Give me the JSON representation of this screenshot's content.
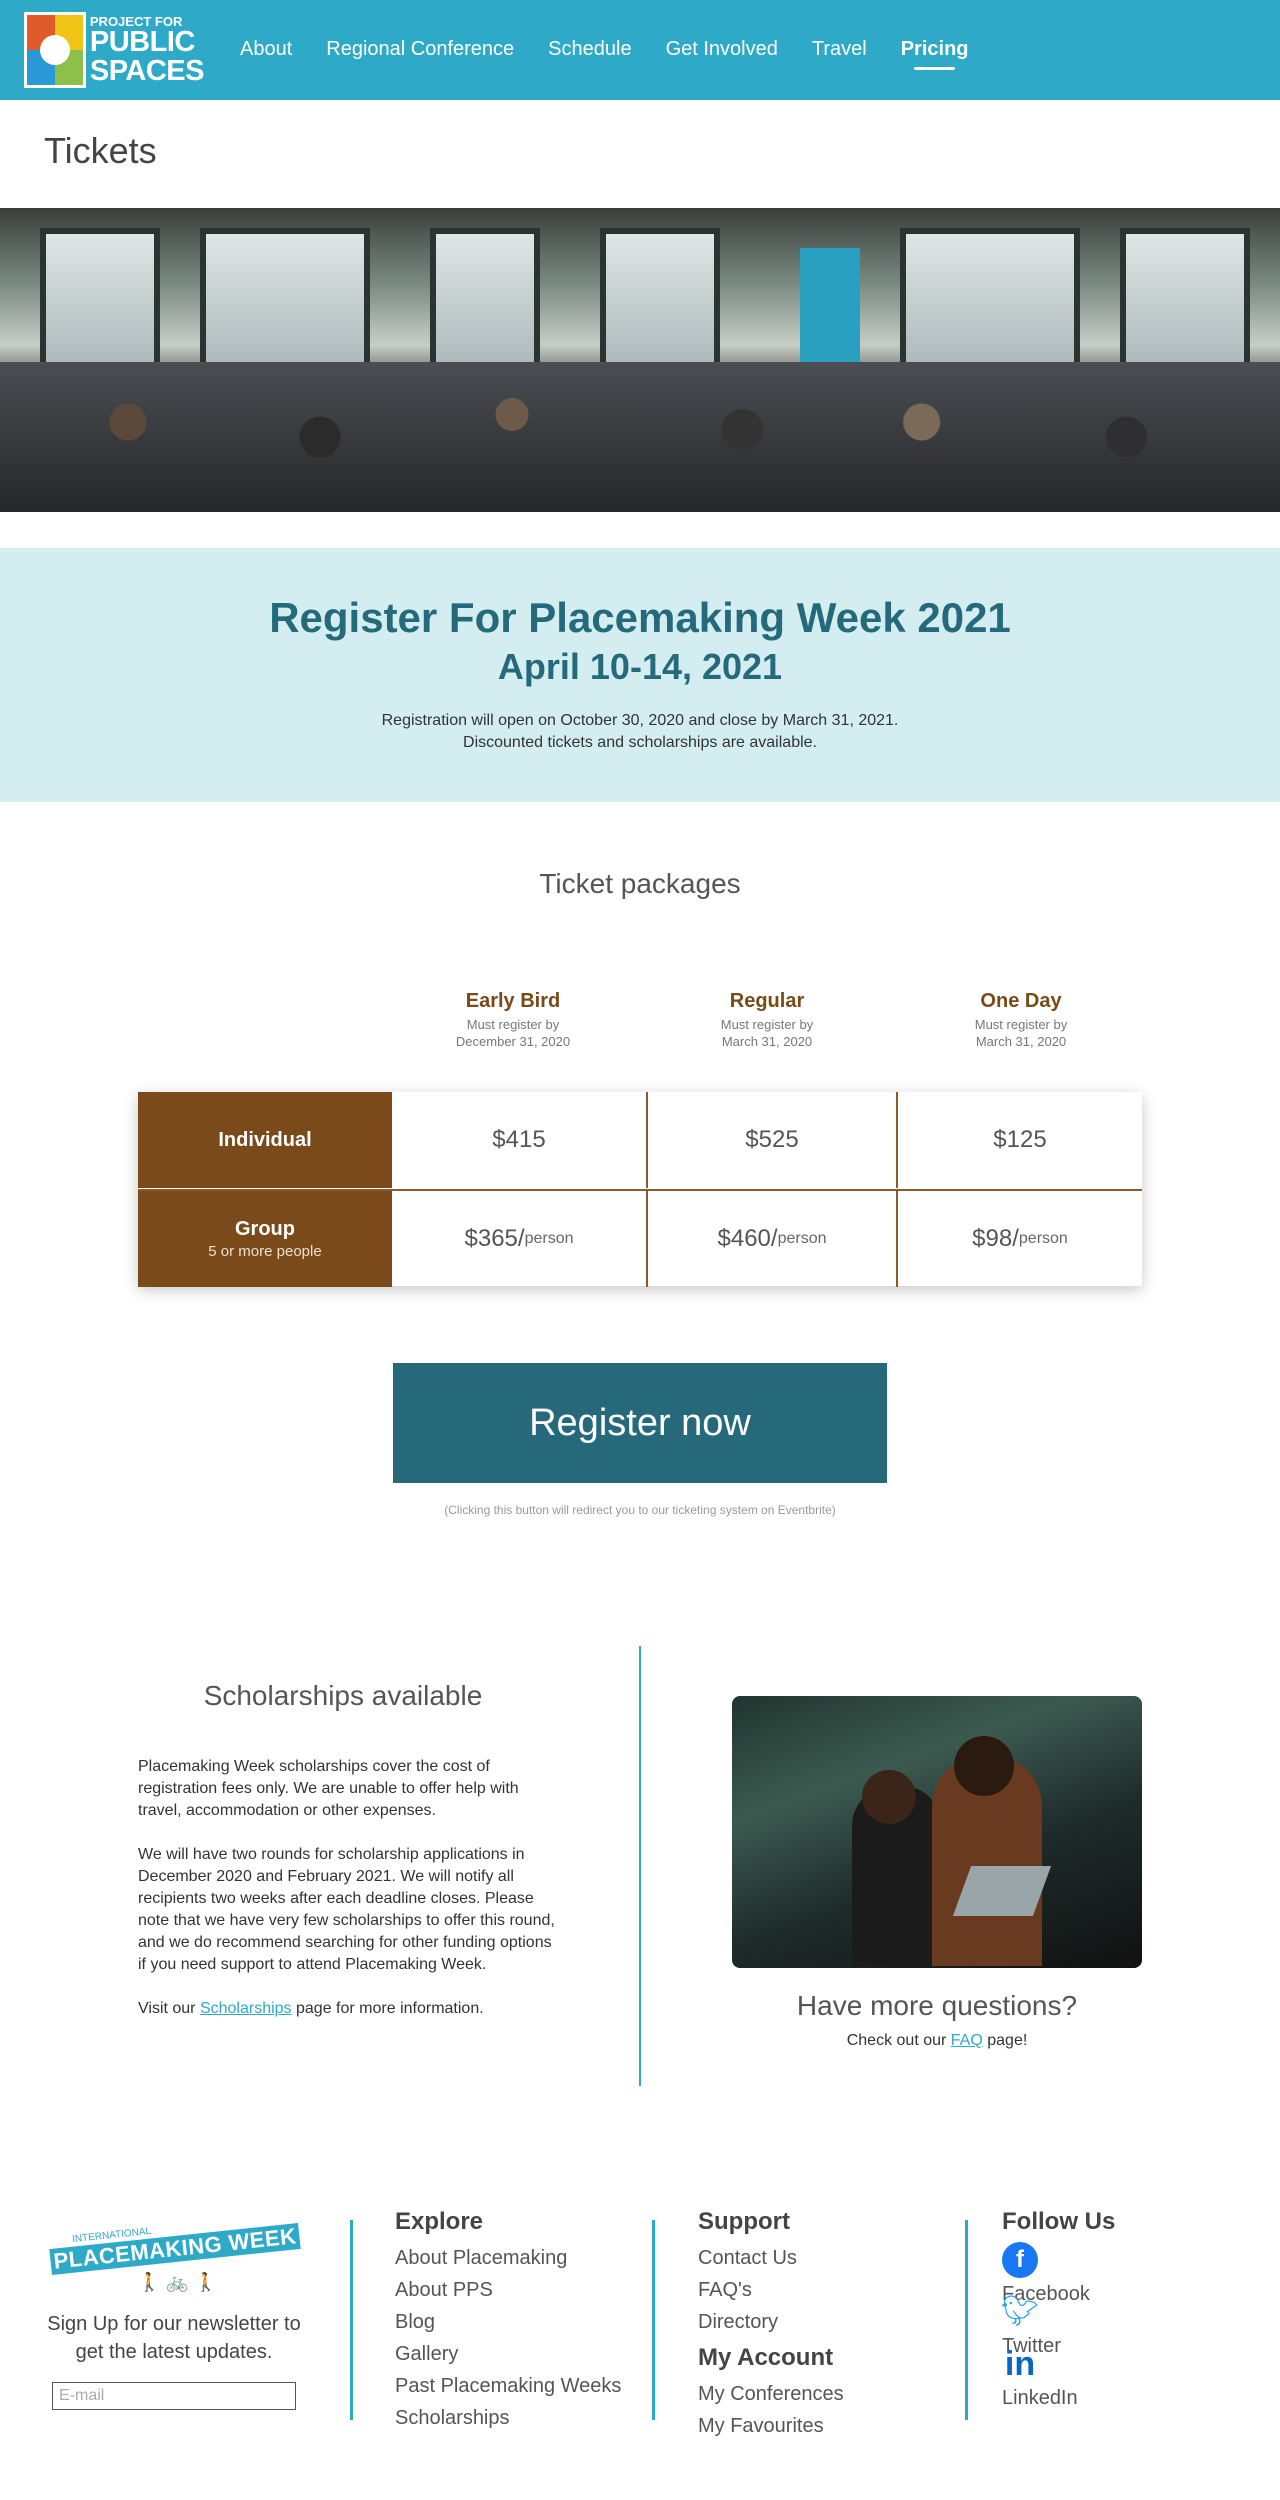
{
  "header": {
    "logo_small": "PROJECT FOR",
    "logo_big_1": "PUBLIC",
    "logo_big_2": "SPACES",
    "nav": [
      {
        "label": "About"
      },
      {
        "label": "Regional Conference"
      },
      {
        "label": "Schedule"
      },
      {
        "label": "Get Involved"
      },
      {
        "label": "Travel"
      },
      {
        "label": "Pricing",
        "active": true
      }
    ]
  },
  "page_title": "Tickets",
  "register": {
    "heading": "Register For Placemaking Week 2021",
    "dates": "April 10-14, 2021",
    "line1": "Registration will open on October 30, 2020 and close by March 31, 2021.",
    "line2": "Discounted tickets and scholarships are available."
  },
  "packages": {
    "title": "Ticket packages",
    "columns": [
      {
        "name": "Early Bird",
        "sub1": "Must register by",
        "sub2": "December 31, 2020"
      },
      {
        "name": "Regular",
        "sub1": "Must register by",
        "sub2": "March 31, 2020"
      },
      {
        "name": "One Day",
        "sub1": "Must register by",
        "sub2": "March 31, 2020"
      }
    ],
    "rows": [
      {
        "label": "Individual",
        "sublabel": "",
        "prices": [
          "$415",
          "$525",
          "$125"
        ],
        "unit": ""
      },
      {
        "label": "Group",
        "sublabel": "5 or more people",
        "prices": [
          "$365/",
          "$460/",
          "$98/"
        ],
        "unit": "person"
      }
    ],
    "register_button": "Register now",
    "redirect_note": "(Clicking this button will redirect you to our ticketing system on Eventbrite)"
  },
  "scholarships": {
    "title": "Scholarships available",
    "p1": "Placemaking Week scholarships cover the cost of registration fees only. We are unable to offer help with travel, accommodation or other expenses.",
    "p2": "We will have two rounds for scholarship applications in December 2020 and February 2021. We will notify all recipients two weeks after each deadline closes. Please note that we have very few scholarships to offer this round, and we do recommend searching for other funding options if you need support to attend Placemaking Week.",
    "p3_before": "Visit our ",
    "p3_link": "Scholarships",
    "p3_after": " page for more information."
  },
  "questions": {
    "title": "Have more questions?",
    "before": "Check out our ",
    "link": "FAQ",
    "after": " page!"
  },
  "footer": {
    "logo_intl": "INTERNATIONAL",
    "logo_name": "PLACEMAKING WEEK",
    "newsletter": "Sign Up for our newsletter to get the latest updates.",
    "email_placeholder": "E-mail",
    "explore": {
      "title": "Explore",
      "links": [
        "About Placemaking",
        "About PPS",
        "Blog",
        "Gallery",
        "Past Placemaking Weeks",
        "Scholarships"
      ]
    },
    "support": {
      "title": "Support",
      "links": [
        "Contact Us",
        "FAQ's",
        "Directory"
      ]
    },
    "account": {
      "title": "My Account",
      "links": [
        "My Conferences",
        "My Favourites"
      ]
    },
    "follow": {
      "title": "Follow Us",
      "links": [
        {
          "label": "Facebook",
          "icon": "facebook-icon"
        },
        {
          "label": "Twitter",
          "icon": "twitter-icon"
        },
        {
          "label": "LinkedIn",
          "icon": "linkedin-icon"
        }
      ]
    }
  },
  "colors": {
    "header": "#2eaac8",
    "brown": "#7a4a1b",
    "teal_dark": "#26697a",
    "band": "#d3edf1"
  }
}
